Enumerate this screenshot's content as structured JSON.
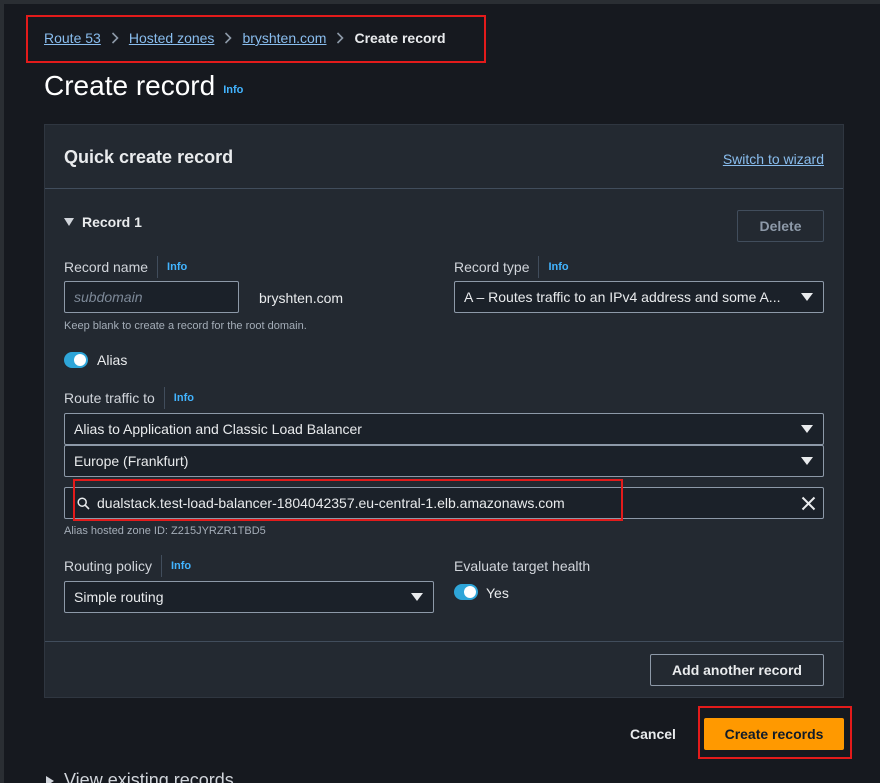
{
  "breadcrumb": {
    "items": [
      "Route 53",
      "Hosted zones",
      "bryshten.com"
    ],
    "current": "Create record"
  },
  "page": {
    "title": "Create record",
    "info": "Info"
  },
  "panel": {
    "title": "Quick create record",
    "switch_link": "Switch to wizard",
    "record_label": "Record 1",
    "delete_label": "Delete"
  },
  "record_name": {
    "label": "Record name",
    "info": "Info",
    "placeholder": "subdomain",
    "domain_suffix": "bryshten.com",
    "help": "Keep blank to create a record for the root domain."
  },
  "record_type": {
    "label": "Record type",
    "info": "Info",
    "value": "A – Routes traffic to an IPv4 address and some A..."
  },
  "alias": {
    "label": "Alias",
    "enabled": true
  },
  "route_traffic": {
    "label": "Route traffic to",
    "info": "Info",
    "endpoint": "Alias to Application and Classic Load Balancer",
    "region": "Europe (Frankfurt)",
    "target": "dualstack.test-load-balancer-1804042357.eu-central-1.elb.amazonaws.com",
    "zone_id": "Alias hosted zone ID: Z215JYRZR1TBD5"
  },
  "routing_policy": {
    "label": "Routing policy",
    "info": "Info",
    "value": "Simple routing"
  },
  "target_health": {
    "label": "Evaluate target health",
    "toggle_label": "Yes",
    "enabled": true
  },
  "actions": {
    "add_another": "Add another record",
    "cancel": "Cancel",
    "create": "Create records"
  },
  "view_existing": "View existing records",
  "colors": {
    "primary": "#ff9900",
    "link": "#89bdee",
    "toggle": "#2ea5d8",
    "highlight": "#e31b1b"
  }
}
